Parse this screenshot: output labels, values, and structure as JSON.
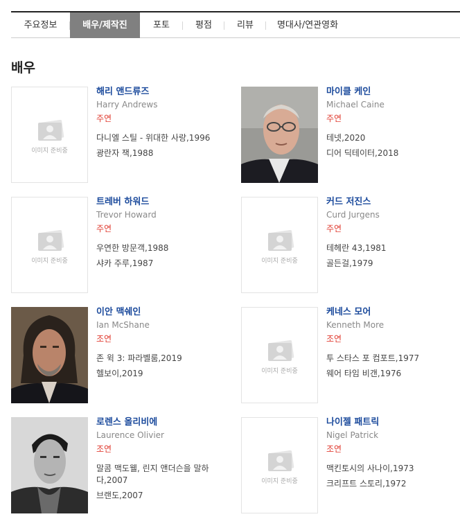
{
  "tabs": [
    {
      "label": "주요정보",
      "active": false
    },
    {
      "label": "배우/제작진",
      "active": true
    },
    {
      "label": "포토",
      "active": false
    },
    {
      "label": "평점",
      "active": false
    },
    {
      "label": "리뷰",
      "active": false
    },
    {
      "label": "명대사/연관영화",
      "active": false
    }
  ],
  "section_title": "배우",
  "placeholder_text": "이미지 준비중",
  "actors": [
    {
      "name_ko": "해리 앤드류즈",
      "name_en": "Harry Andrews",
      "role": "주연",
      "has_photo": false,
      "works": [
        "다니엘 스틸 - 위대한 사랑,1996",
        "광란자 잭,1988"
      ]
    },
    {
      "name_ko": "마이클 케인",
      "name_en": "Michael Caine",
      "role": "주연",
      "has_photo": true,
      "works": [
        "테넷,2020",
        "디어 딕테이터,2018"
      ]
    },
    {
      "name_ko": "트레버 하워드",
      "name_en": "Trevor Howard",
      "role": "주연",
      "has_photo": false,
      "works": [
        "우연한 방문객,1988",
        "샤카 주루,1987"
      ]
    },
    {
      "name_ko": "커드 저진스",
      "name_en": "Curd Jurgens",
      "role": "주연",
      "has_photo": false,
      "works": [
        "테헤란 43,1981",
        "골든걸,1979"
      ]
    },
    {
      "name_ko": "이안 맥쉐인",
      "name_en": "Ian McShane",
      "role": "조연",
      "has_photo": true,
      "works": [
        "존 윅 3: 파라벨룸,2019",
        "헬보이,2019"
      ]
    },
    {
      "name_ko": "케네스 모어",
      "name_en": "Kenneth More",
      "role": "조연",
      "has_photo": false,
      "works": [
        "투 스타스 포 컴포트,1977",
        "웨어 타임 비갠,1976"
      ]
    },
    {
      "name_ko": "로렌스 올리비에",
      "name_en": "Laurence Olivier",
      "role": "조연",
      "has_photo": true,
      "works": [
        "말콤 맥도웰, 린지 앤더슨을 말하다,2007",
        "브랜도,2007"
      ]
    },
    {
      "name_ko": "나이젤 패트릭",
      "name_en": "Nigel Patrick",
      "role": "조연",
      "has_photo": false,
      "works": [
        "맥킨토시의 사나이,1973",
        "크리프트 스토리,1972"
      ]
    }
  ]
}
